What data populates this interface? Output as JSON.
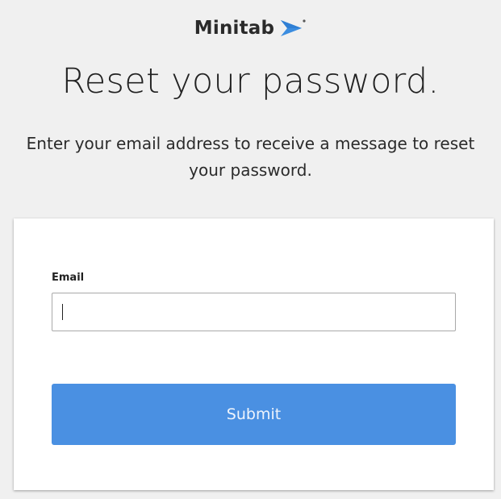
{
  "brand": {
    "name": "Minitab",
    "mark_color": "#3b8de0"
  },
  "heading": {
    "title": "Reset your password.",
    "subtitle": "Enter your email address to receive a message to reset your password."
  },
  "form": {
    "email_label": "Email",
    "email_value": "",
    "email_placeholder": "",
    "submit_label": "Submit"
  },
  "colors": {
    "background": "#f0f0f0",
    "card": "#ffffff",
    "button": "#4a90e2"
  }
}
